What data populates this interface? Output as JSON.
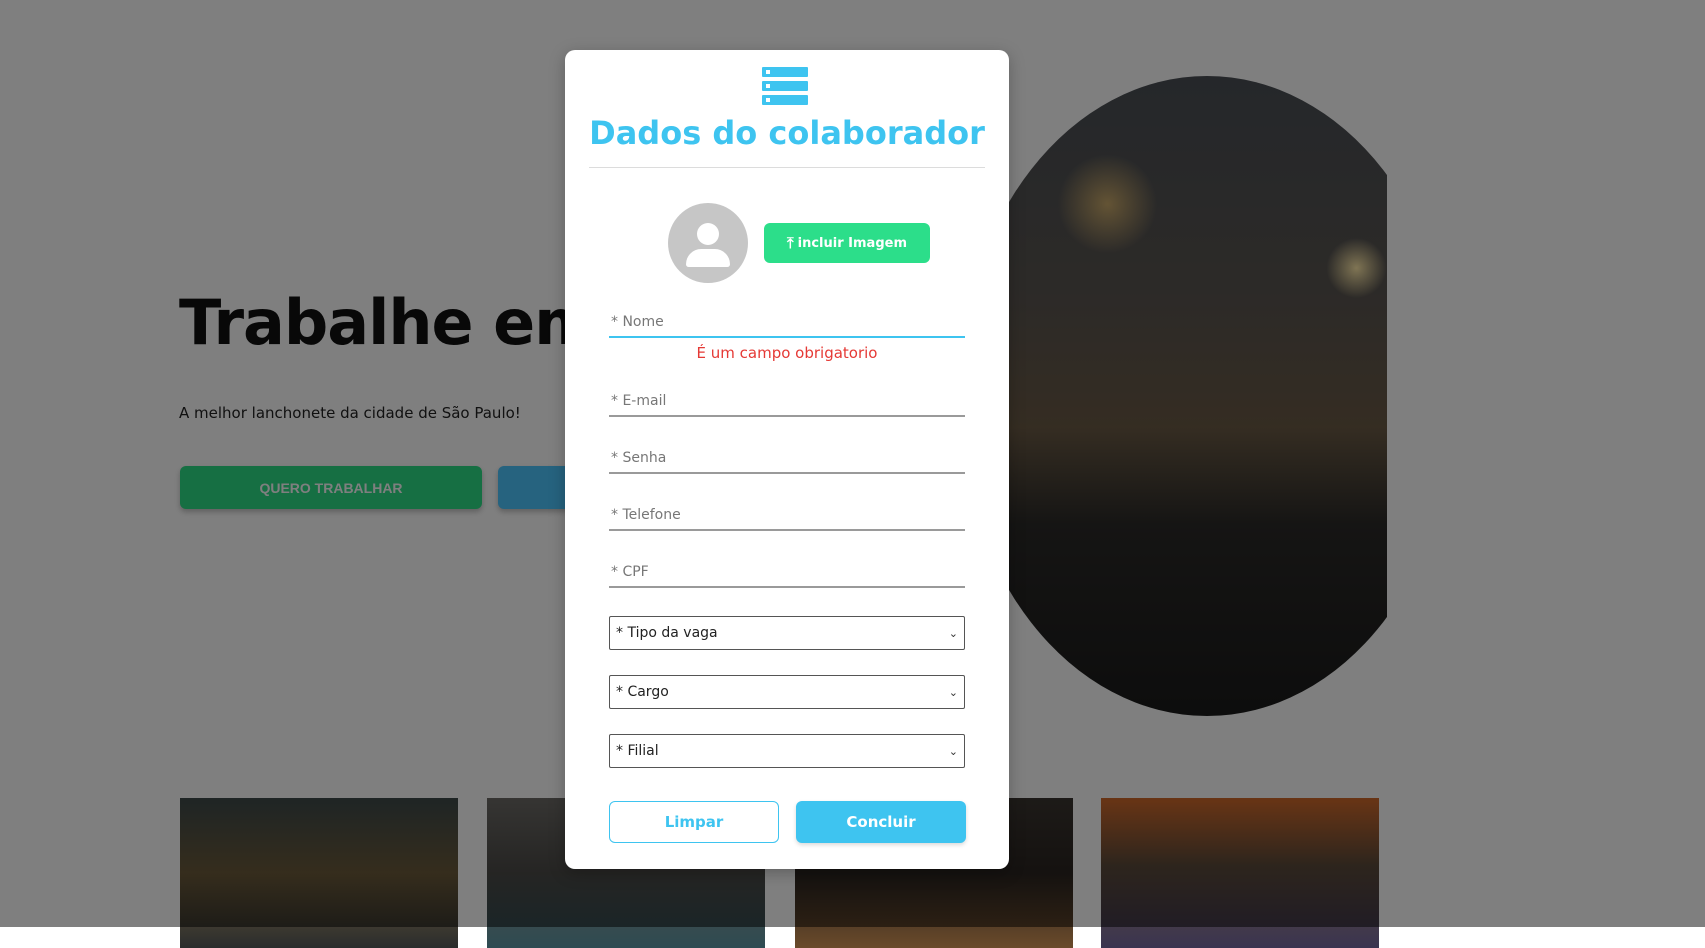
{
  "background": {
    "hero_title": "Trabalhe em",
    "hero_subtitle": "A melhor lanchonete da cidade de São Paulo!",
    "primary_button": "QUERO TRABALHAR"
  },
  "modal": {
    "icon": "server-stack-icon",
    "title": "Dados do colaborador",
    "avatar_icon": "user-avatar-icon",
    "upload_label": "incluir Imagem",
    "upload_icon": "upload-arrow-icon",
    "fields": {
      "nome_placeholder": "* Nome",
      "nome_error": "É um campo obrigatorio",
      "email_placeholder": "* E-mail",
      "senha_placeholder": "* Senha",
      "telefone_placeholder": "* Telefone",
      "cpf_placeholder": "* CPF"
    },
    "selects": {
      "tipo_vaga": "* Tipo da vaga",
      "cargo": "* Cargo",
      "filial": "* Filial"
    },
    "buttons": {
      "clear": "Limpar",
      "submit": "Concluir"
    }
  },
  "colors": {
    "accent": "#3ec4f0",
    "success": "#2cde8a",
    "error": "#e53935"
  }
}
